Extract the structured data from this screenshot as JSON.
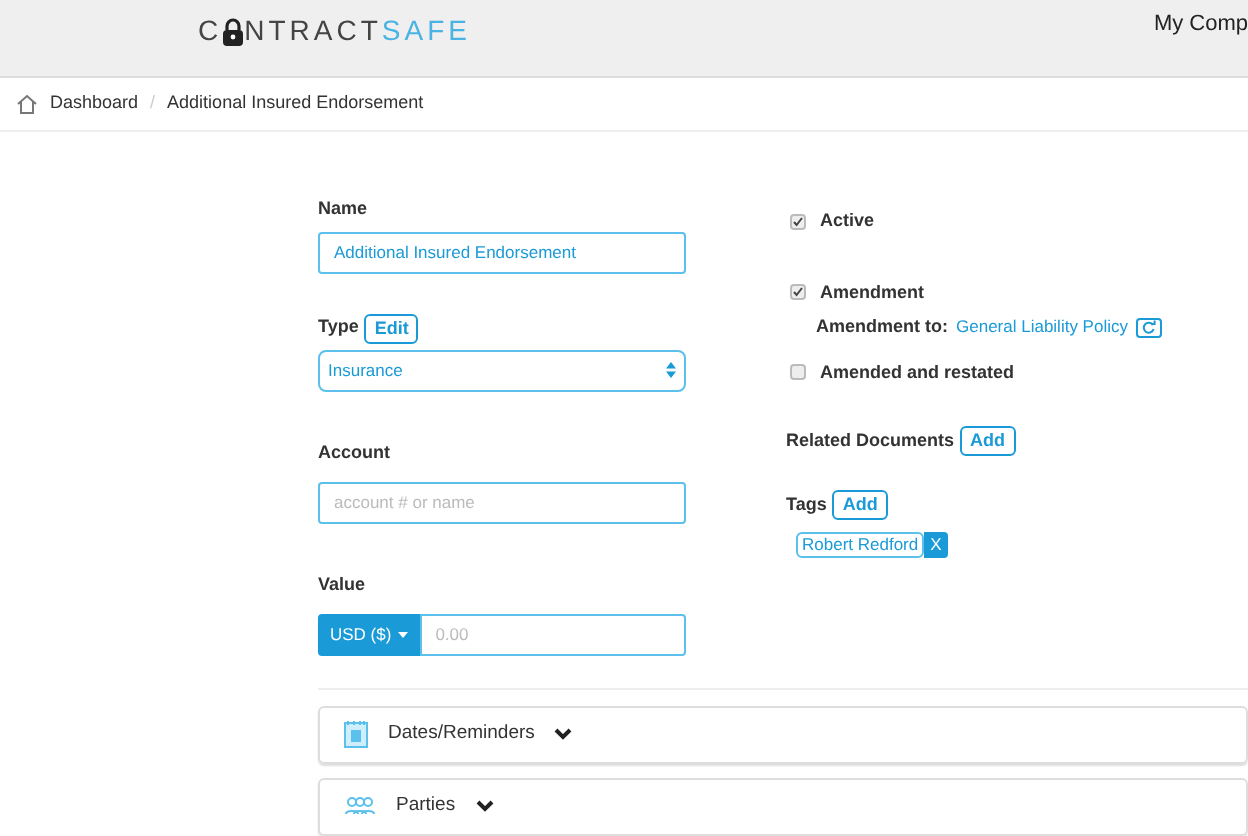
{
  "header": {
    "logo": {
      "first": "C",
      "middle": "NTRACT",
      "accent": "SAFE"
    },
    "account": "My Comp"
  },
  "breadcrumb": [
    "Dashboard",
    "Additional Insured Endorsement"
  ],
  "breadcrumb_separator": "/",
  "form": {
    "name": {
      "label": "Name",
      "value": "Additional Insured Endorsement"
    },
    "type": {
      "label": "Type",
      "edit": "Edit",
      "value": "Insurance"
    },
    "account": {
      "label": "Account",
      "placeholder": "account # or name"
    },
    "value": {
      "label": "Value",
      "currency": "USD ($)",
      "placeholder": "0.00"
    }
  },
  "options": [
    {
      "label": "Active",
      "checked": true
    },
    {
      "label": "Amendment",
      "checked": true,
      "detail_label": "Amendment to:",
      "detail_link": "General Liability Policy"
    },
    {
      "label": "Amended and restated",
      "checked": false
    }
  ],
  "related": {
    "label": "Related Documents",
    "add": "Add"
  },
  "tags": {
    "label": "Tags",
    "add": "Add",
    "items": [
      {
        "text": "Robert Redford",
        "remove": "X"
      }
    ]
  },
  "sections": [
    {
      "kind": "calendar",
      "title": "Dates/Reminders",
      "expanded": false
    },
    {
      "kind": "people",
      "title": "Parties",
      "expanded": false
    }
  ]
}
